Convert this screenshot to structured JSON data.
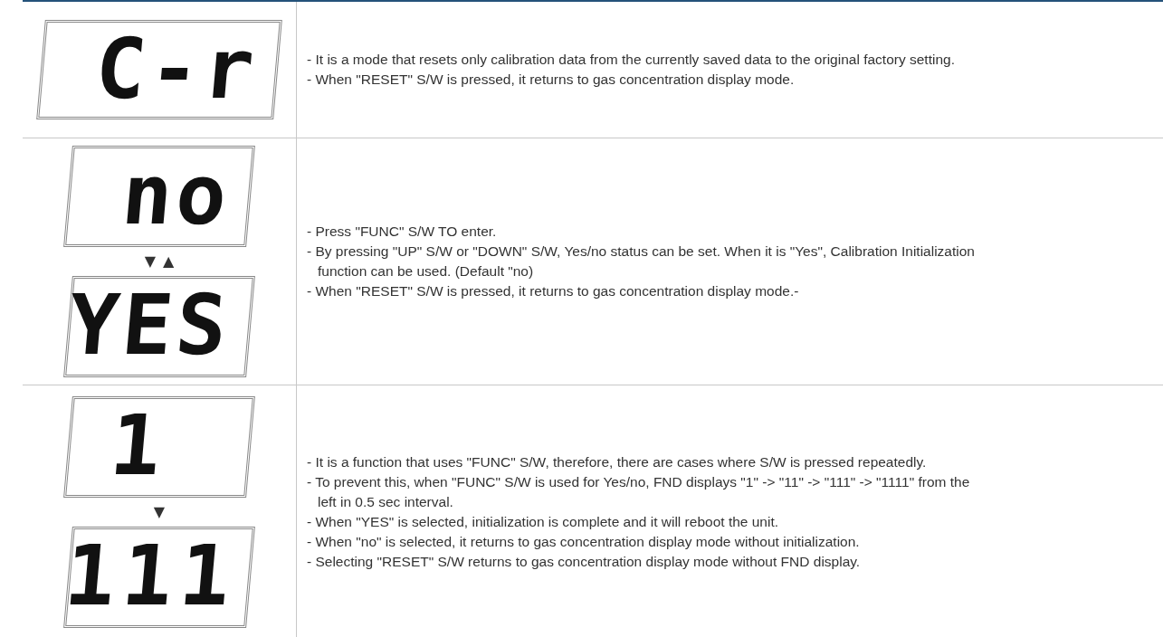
{
  "rows": [
    {
      "displays": [
        {
          "text": "C-r"
        }
      ],
      "arrows": [],
      "notes": [
        "- It is a mode that resets only calibration data from the currently saved data to the original factory setting.",
        "- When \"RESET\" S/W is pressed, it returns to gas concentration display mode."
      ]
    },
    {
      "displays": [
        {
          "text": "no"
        },
        {
          "text": "YES"
        }
      ],
      "arrows": [
        "▼",
        "▲"
      ],
      "notes": [
        "- Press \"FUNC\" S/W TO enter.",
        "- By pressing \"UP\" S/W or \"DOWN\" S/W, Yes/no status can be set. When it is \"Yes\", Calibration Initialization function can be used. (Default \"no)",
        "- When \"RESET\" S/W is pressed, it returns to gas concentration display mode.-"
      ]
    },
    {
      "displays": [
        {
          "text": "1"
        },
        {
          "text": "111"
        }
      ],
      "arrows": [
        "▼"
      ],
      "notes": [
        "- It is a function that uses \"FUNC\" S/W, therefore, there are cases where S/W is pressed repeatedly.",
        "- To prevent this, when \"FUNC\" S/W is used for Yes/no, FND displays \"1\" -> \"11\" -> \"111\" -> \"1111\" from the left in 0.5 sec interval.",
        "- When \"YES\" is selected, initialization is complete and it will reboot the unit.",
        "- When \"no\" is selected, it returns to gas concentration display mode without initialization.",
        "- Selecting \"RESET\" S/W returns to gas concentration display mode without FND display."
      ]
    }
  ]
}
